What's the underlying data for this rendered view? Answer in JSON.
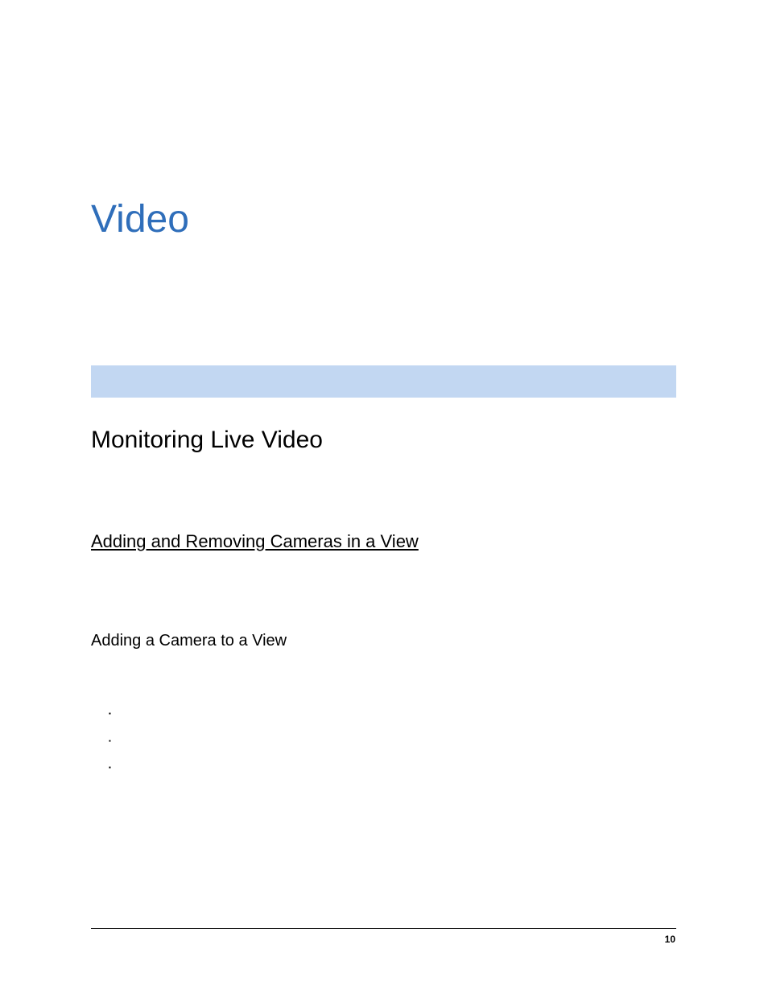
{
  "title": "Video",
  "section": "Monitoring Live Video",
  "subsection": "Adding and Removing Cameras in a View",
  "subsubsection": "Adding a Camera to a View",
  "page_number": "10"
}
